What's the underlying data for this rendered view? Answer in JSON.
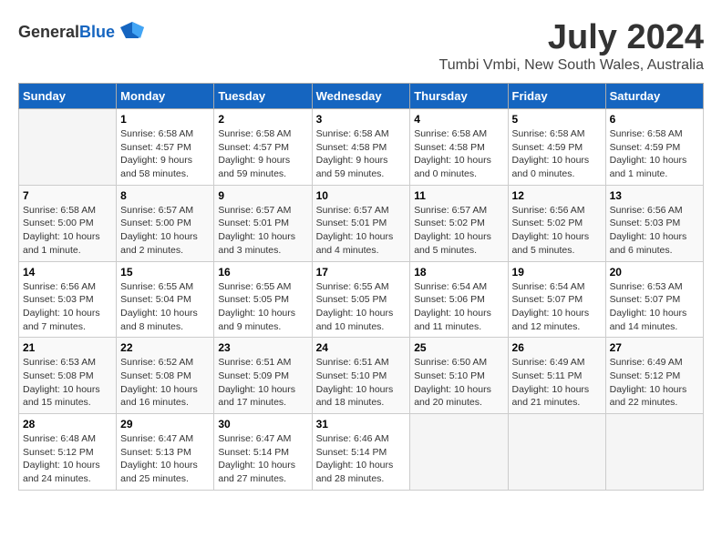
{
  "header": {
    "logo_general": "General",
    "logo_blue": "Blue",
    "month_year": "July 2024",
    "location": "Tumbi Vmbi, New South Wales, Australia"
  },
  "days_of_week": [
    "Sunday",
    "Monday",
    "Tuesday",
    "Wednesday",
    "Thursday",
    "Friday",
    "Saturday"
  ],
  "weeks": [
    [
      {
        "day": "",
        "sunrise": "",
        "sunset": "",
        "daylight": ""
      },
      {
        "day": "1",
        "sunrise": "6:58 AM",
        "sunset": "4:57 PM",
        "daylight": "9 hours and 58 minutes."
      },
      {
        "day": "2",
        "sunrise": "6:58 AM",
        "sunset": "4:57 PM",
        "daylight": "9 hours and 59 minutes."
      },
      {
        "day": "3",
        "sunrise": "6:58 AM",
        "sunset": "4:58 PM",
        "daylight": "9 hours and 59 minutes."
      },
      {
        "day": "4",
        "sunrise": "6:58 AM",
        "sunset": "4:58 PM",
        "daylight": "10 hours and 0 minutes."
      },
      {
        "day": "5",
        "sunrise": "6:58 AM",
        "sunset": "4:59 PM",
        "daylight": "10 hours and 0 minutes."
      },
      {
        "day": "6",
        "sunrise": "6:58 AM",
        "sunset": "4:59 PM",
        "daylight": "10 hours and 1 minute."
      }
    ],
    [
      {
        "day": "7",
        "sunrise": "6:58 AM",
        "sunset": "5:00 PM",
        "daylight": "10 hours and 1 minute."
      },
      {
        "day": "8",
        "sunrise": "6:57 AM",
        "sunset": "5:00 PM",
        "daylight": "10 hours and 2 minutes."
      },
      {
        "day": "9",
        "sunrise": "6:57 AM",
        "sunset": "5:01 PM",
        "daylight": "10 hours and 3 minutes."
      },
      {
        "day": "10",
        "sunrise": "6:57 AM",
        "sunset": "5:01 PM",
        "daylight": "10 hours and 4 minutes."
      },
      {
        "day": "11",
        "sunrise": "6:57 AM",
        "sunset": "5:02 PM",
        "daylight": "10 hours and 5 minutes."
      },
      {
        "day": "12",
        "sunrise": "6:56 AM",
        "sunset": "5:02 PM",
        "daylight": "10 hours and 5 minutes."
      },
      {
        "day": "13",
        "sunrise": "6:56 AM",
        "sunset": "5:03 PM",
        "daylight": "10 hours and 6 minutes."
      }
    ],
    [
      {
        "day": "14",
        "sunrise": "6:56 AM",
        "sunset": "5:03 PM",
        "daylight": "10 hours and 7 minutes."
      },
      {
        "day": "15",
        "sunrise": "6:55 AM",
        "sunset": "5:04 PM",
        "daylight": "10 hours and 8 minutes."
      },
      {
        "day": "16",
        "sunrise": "6:55 AM",
        "sunset": "5:05 PM",
        "daylight": "10 hours and 9 minutes."
      },
      {
        "day": "17",
        "sunrise": "6:55 AM",
        "sunset": "5:05 PM",
        "daylight": "10 hours and 10 minutes."
      },
      {
        "day": "18",
        "sunrise": "6:54 AM",
        "sunset": "5:06 PM",
        "daylight": "10 hours and 11 minutes."
      },
      {
        "day": "19",
        "sunrise": "6:54 AM",
        "sunset": "5:07 PM",
        "daylight": "10 hours and 12 minutes."
      },
      {
        "day": "20",
        "sunrise": "6:53 AM",
        "sunset": "5:07 PM",
        "daylight": "10 hours and 14 minutes."
      }
    ],
    [
      {
        "day": "21",
        "sunrise": "6:53 AM",
        "sunset": "5:08 PM",
        "daylight": "10 hours and 15 minutes."
      },
      {
        "day": "22",
        "sunrise": "6:52 AM",
        "sunset": "5:08 PM",
        "daylight": "10 hours and 16 minutes."
      },
      {
        "day": "23",
        "sunrise": "6:51 AM",
        "sunset": "5:09 PM",
        "daylight": "10 hours and 17 minutes."
      },
      {
        "day": "24",
        "sunrise": "6:51 AM",
        "sunset": "5:10 PM",
        "daylight": "10 hours and 18 minutes."
      },
      {
        "day": "25",
        "sunrise": "6:50 AM",
        "sunset": "5:10 PM",
        "daylight": "10 hours and 20 minutes."
      },
      {
        "day": "26",
        "sunrise": "6:49 AM",
        "sunset": "5:11 PM",
        "daylight": "10 hours and 21 minutes."
      },
      {
        "day": "27",
        "sunrise": "6:49 AM",
        "sunset": "5:12 PM",
        "daylight": "10 hours and 22 minutes."
      }
    ],
    [
      {
        "day": "28",
        "sunrise": "6:48 AM",
        "sunset": "5:12 PM",
        "daylight": "10 hours and 24 minutes."
      },
      {
        "day": "29",
        "sunrise": "6:47 AM",
        "sunset": "5:13 PM",
        "daylight": "10 hours and 25 minutes."
      },
      {
        "day": "30",
        "sunrise": "6:47 AM",
        "sunset": "5:14 PM",
        "daylight": "10 hours and 27 minutes."
      },
      {
        "day": "31",
        "sunrise": "6:46 AM",
        "sunset": "5:14 PM",
        "daylight": "10 hours and 28 minutes."
      },
      {
        "day": "",
        "sunrise": "",
        "sunset": "",
        "daylight": ""
      },
      {
        "day": "",
        "sunrise": "",
        "sunset": "",
        "daylight": ""
      },
      {
        "day": "",
        "sunrise": "",
        "sunset": "",
        "daylight": ""
      }
    ]
  ],
  "labels": {
    "sunrise_prefix": "Sunrise: ",
    "sunset_prefix": "Sunset: ",
    "daylight_prefix": "Daylight: "
  }
}
